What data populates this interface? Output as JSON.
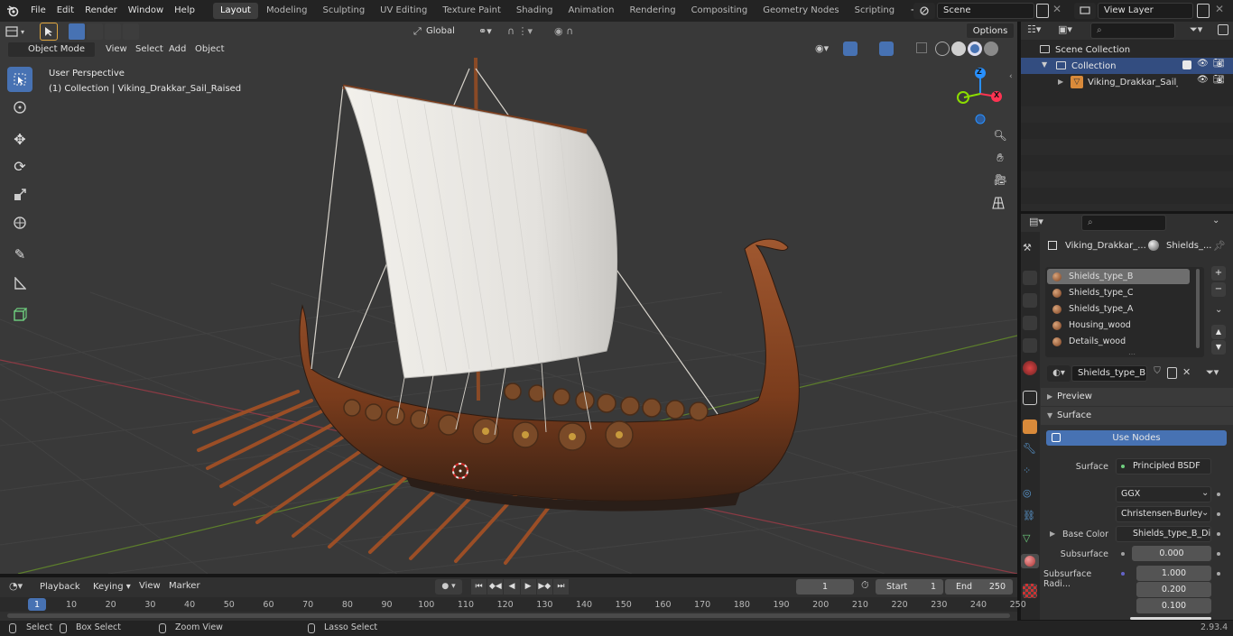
{
  "menu": {
    "items": [
      "File",
      "Edit",
      "Render",
      "Window",
      "Help"
    ]
  },
  "workspaces": {
    "tabs": [
      "Layout",
      "Modeling",
      "Sculpting",
      "UV Editing",
      "Texture Paint",
      "Shading",
      "Animation",
      "Rendering",
      "Compositing",
      "Geometry Nodes",
      "Scripting"
    ],
    "active": "Layout",
    "add": "+"
  },
  "scene": {
    "name": "Scene",
    "view_layer": "View Layer"
  },
  "viewport": {
    "header": {
      "mode": "Object Mode",
      "view": "View",
      "select": "Select",
      "add": "Add",
      "object": "Object",
      "orientation": "Global",
      "options": "Options"
    },
    "overlay": {
      "perspective": "User Perspective",
      "collection_object": "(1) Collection | Viking_Drakkar_Sail_Raised"
    },
    "gizmo": {
      "x": "X",
      "y": "Y",
      "z": "Z"
    },
    "colors": {
      "x_axis": "#ff3352",
      "y_axis": "#8bdc00",
      "z_axis": "#2890ff",
      "active": "#4772b3"
    }
  },
  "outliner": {
    "scene_collection": "Scene Collection",
    "collection": "Collection",
    "object": "Viking_Drakkar_Sail_Raised"
  },
  "properties": {
    "breadcrumb": {
      "object": "Viking_Drakkar_...",
      "material": "Shields_..."
    },
    "materials": [
      "Shields_type_B",
      "Shields_type_C",
      "Shields_type_A",
      "Housing_wood",
      "Details_wood"
    ],
    "selected_material": "Shields_type_B",
    "panels": {
      "preview": "Preview",
      "surface": "Surface"
    },
    "use_nodes": "Use Nodes",
    "surface": {
      "label": "Surface",
      "value": "Principled BSDF"
    },
    "distribution": "GGX",
    "subsurface_method": "Christensen-Burley",
    "base_color": {
      "label": "Base Color",
      "value": "Shields_type_B_Diff..."
    },
    "subsurface": {
      "label": "Subsurface",
      "value": "0.000"
    },
    "subsurface_radius": {
      "label": "Subsurface Radi...",
      "values": [
        "1.000",
        "0.200",
        "0.100"
      ]
    }
  },
  "timeline": {
    "playback": "Playback",
    "keying": "Keying",
    "view": "View",
    "marker": "Marker",
    "current_frame": "1",
    "start_label": "Start",
    "start": "1",
    "end_label": "End",
    "end": "250",
    "ticks": [
      "1",
      "10",
      "20",
      "30",
      "40",
      "50",
      "60",
      "70",
      "80",
      "90",
      "100",
      "110",
      "120",
      "130",
      "140",
      "150",
      "160",
      "170",
      "180",
      "190",
      "200",
      "210",
      "220",
      "230",
      "240",
      "250"
    ]
  },
  "status": {
    "select": "Select",
    "box_select": "Box Select",
    "zoom_view": "Zoom View",
    "lasso_select": "Lasso Select",
    "version": "2.93.4"
  }
}
